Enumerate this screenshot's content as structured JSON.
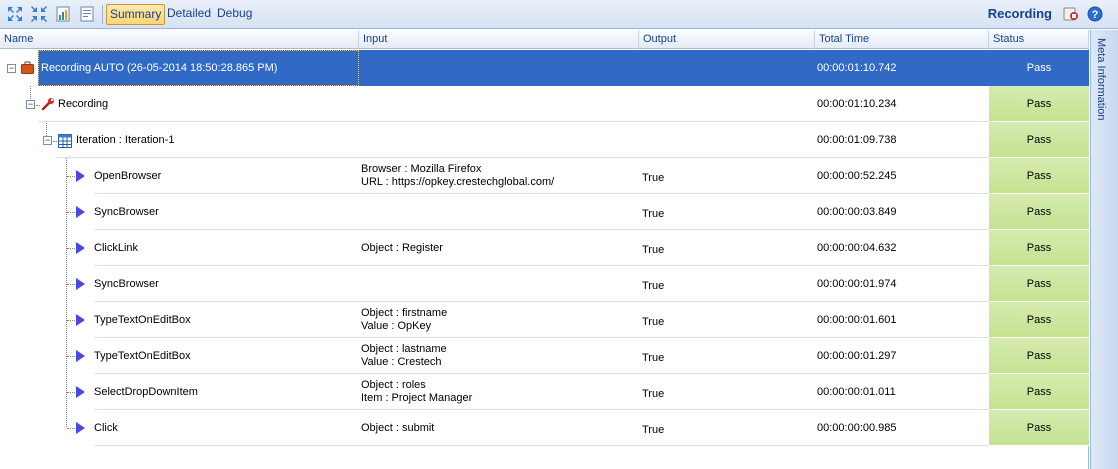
{
  "toolbar": {
    "icons": [
      "expand-all-icon",
      "collapse-all-icon",
      "report-icon",
      "export-icon"
    ],
    "tabs": [
      {
        "label": "Summary",
        "active": true
      },
      {
        "label": "Detailed",
        "active": false
      },
      {
        "label": "Debug",
        "active": false
      }
    ],
    "title": "Recording",
    "right_icons": [
      "stop-recording-icon",
      "help-icon"
    ]
  },
  "grid": {
    "columns": [
      "Name",
      "Input",
      "Output",
      "Total Time",
      "Status"
    ],
    "rows": [
      {
        "name": "Recording AUTO (26-05-2014 18:50:28.865 PM)",
        "input": [],
        "output": "",
        "time": "00:00:01:10.742",
        "status": "Pass",
        "icon": "suitcase-icon",
        "selected": true
      },
      {
        "name": "Recording",
        "input": [],
        "output": "",
        "time": "00:00:01:10.234",
        "status": "Pass",
        "icon": "wrench-icon"
      },
      {
        "name": "Iteration : Iteration-1",
        "input": [],
        "output": "",
        "time": "00:00:01:09.738",
        "status": "Pass",
        "icon": "table-icon"
      },
      {
        "name": "OpenBrowser",
        "input": [
          "Browser : Mozilla Firefox",
          "URL : https://opkey.crestechglobal.com/"
        ],
        "output": "True",
        "time": "00:00:00:52.245",
        "status": "Pass",
        "icon": "play-step-icon"
      },
      {
        "name": "SyncBrowser",
        "input": [],
        "output": "True",
        "time": "00:00:00:03.849",
        "status": "Pass",
        "icon": "play-step-icon"
      },
      {
        "name": "ClickLink",
        "input": [
          "Object : Register"
        ],
        "output": "True",
        "time": "00:00:00:04.632",
        "status": "Pass",
        "icon": "play-step-icon"
      },
      {
        "name": "SyncBrowser",
        "input": [],
        "output": "True",
        "time": "00:00:00:01.974",
        "status": "Pass",
        "icon": "play-step-icon"
      },
      {
        "name": "TypeTextOnEditBox",
        "input": [
          "Object : firstname",
          "Value : OpKey"
        ],
        "output": "True",
        "time": "00:00:00:01.601",
        "status": "Pass",
        "icon": "play-step-icon"
      },
      {
        "name": "TypeTextOnEditBox",
        "input": [
          "Object : lastname",
          "Value : Crestech"
        ],
        "output": "True",
        "time": "00:00:00:01.297",
        "status": "Pass",
        "icon": "play-step-icon"
      },
      {
        "name": "SelectDropDownItem",
        "input": [
          "Object : roles",
          "Item : Project Manager"
        ],
        "output": "True",
        "time": "00:00:00:01.011",
        "status": "Pass",
        "icon": "play-step-icon"
      },
      {
        "name": "Click",
        "input": [
          "Object : submit"
        ],
        "output": "True",
        "time": "00:00:00:00.985",
        "status": "Pass",
        "icon": "play-step-icon"
      }
    ]
  },
  "side_panel": {
    "label": "Meta Information"
  }
}
